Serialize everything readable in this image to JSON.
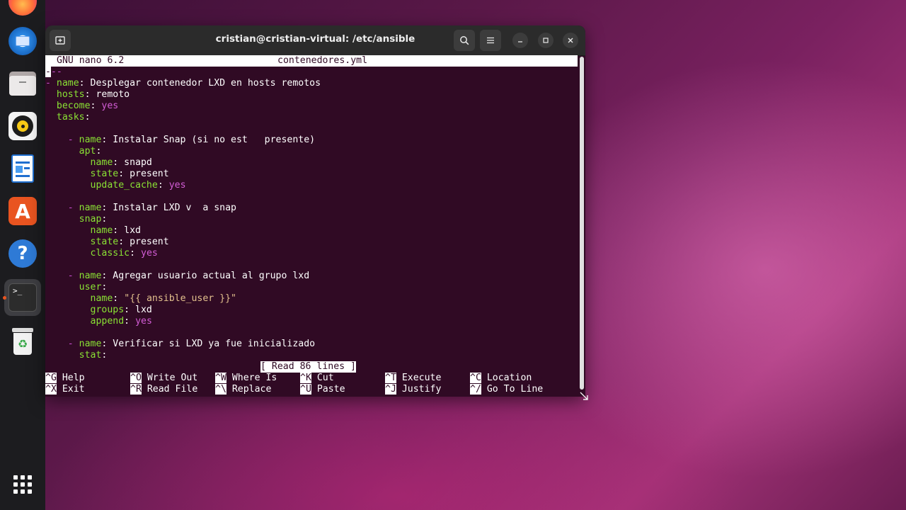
{
  "window": {
    "title": "cristian@cristian-virtual: /etc/ansible"
  },
  "dock": {
    "items": [
      {
        "name": "firefox-icon"
      },
      {
        "name": "thunderbird-icon"
      },
      {
        "name": "files-icon"
      },
      {
        "name": "rhythmbox-icon"
      },
      {
        "name": "libreoffice-writer-icon"
      },
      {
        "name": "app-center-icon"
      },
      {
        "name": "help-icon"
      },
      {
        "name": "terminal-icon"
      },
      {
        "name": "trash-icon"
      },
      {
        "name": "show-apps-icon"
      }
    ]
  },
  "nano": {
    "version": "GNU nano 6.2",
    "filename": "contenedores.yml",
    "status": "[ Read 86 lines ]",
    "lines": [
      [
        [
          "d",
          "---"
        ]
      ],
      [
        [
          "d",
          "- "
        ],
        [
          "k",
          "name"
        ],
        [
          "v",
          ": Desplegar contenedor LXD en hosts remotos"
        ]
      ],
      [
        [
          "v",
          "  "
        ],
        [
          "k",
          "hosts"
        ],
        [
          "v",
          ": remoto"
        ]
      ],
      [
        [
          "v",
          "  "
        ],
        [
          "k",
          "become"
        ],
        [
          "v",
          ": "
        ],
        [
          "b",
          "yes"
        ]
      ],
      [
        [
          "v",
          "  "
        ],
        [
          "k",
          "tasks"
        ],
        [
          "v",
          ":"
        ]
      ],
      [
        [
          "v",
          ""
        ]
      ],
      [
        [
          "d",
          "    - "
        ],
        [
          "k",
          "name"
        ],
        [
          "v",
          ": Instalar Snap (si no est   presente)"
        ]
      ],
      [
        [
          "v",
          "      "
        ],
        [
          "k",
          "apt"
        ],
        [
          "v",
          ":"
        ]
      ],
      [
        [
          "v",
          "        "
        ],
        [
          "k",
          "name"
        ],
        [
          "v",
          ": snapd"
        ]
      ],
      [
        [
          "v",
          "        "
        ],
        [
          "k",
          "state"
        ],
        [
          "v",
          ": present"
        ]
      ],
      [
        [
          "v",
          "        "
        ],
        [
          "k",
          "update_cache"
        ],
        [
          "v",
          ": "
        ],
        [
          "b",
          "yes"
        ]
      ],
      [
        [
          "v",
          ""
        ]
      ],
      [
        [
          "d",
          "    - "
        ],
        [
          "k",
          "name"
        ],
        [
          "v",
          ": Instalar LXD v  a snap"
        ]
      ],
      [
        [
          "v",
          "      "
        ],
        [
          "k",
          "snap"
        ],
        [
          "v",
          ":"
        ]
      ],
      [
        [
          "v",
          "        "
        ],
        [
          "k",
          "name"
        ],
        [
          "v",
          ": lxd"
        ]
      ],
      [
        [
          "v",
          "        "
        ],
        [
          "k",
          "state"
        ],
        [
          "v",
          ": present"
        ]
      ],
      [
        [
          "v",
          "        "
        ],
        [
          "k",
          "classic"
        ],
        [
          "v",
          ": "
        ],
        [
          "b",
          "yes"
        ]
      ],
      [
        [
          "v",
          ""
        ]
      ],
      [
        [
          "d",
          "    - "
        ],
        [
          "k",
          "name"
        ],
        [
          "v",
          ": Agregar usuario actual al grupo lxd"
        ]
      ],
      [
        [
          "v",
          "      "
        ],
        [
          "k",
          "user"
        ],
        [
          "v",
          ":"
        ]
      ],
      [
        [
          "v",
          "        "
        ],
        [
          "k",
          "name"
        ],
        [
          "v",
          ": "
        ],
        [
          "q",
          "\"{{ ansible_user }}\""
        ]
      ],
      [
        [
          "v",
          "        "
        ],
        [
          "k",
          "groups"
        ],
        [
          "v",
          ": lxd"
        ]
      ],
      [
        [
          "v",
          "        "
        ],
        [
          "k",
          "append"
        ],
        [
          "v",
          ": "
        ],
        [
          "b",
          "yes"
        ]
      ],
      [
        [
          "v",
          ""
        ]
      ],
      [
        [
          "d",
          "    - "
        ],
        [
          "k",
          "name"
        ],
        [
          "v",
          ": Verificar si LXD ya fue inicializado"
        ]
      ],
      [
        [
          "v",
          "      "
        ],
        [
          "k",
          "stat"
        ],
        [
          "v",
          ":"
        ]
      ]
    ],
    "shortcuts": [
      {
        "key": "^G",
        "label": "Help"
      },
      {
        "key": "^X",
        "label": "Exit"
      },
      {
        "key": "^O",
        "label": "Write Out"
      },
      {
        "key": "^R",
        "label": "Read File"
      },
      {
        "key": "^W",
        "label": "Where Is"
      },
      {
        "key": "^\\",
        "label": "Replace"
      },
      {
        "key": "^K",
        "label": "Cut"
      },
      {
        "key": "^U",
        "label": "Paste"
      },
      {
        "key": "^T",
        "label": "Execute"
      },
      {
        "key": "^J",
        "label": "Justify"
      },
      {
        "key": "^C",
        "label": "Location"
      },
      {
        "key": "^/",
        "label": "Go To Line"
      }
    ]
  },
  "colors": {
    "terminal_bg": "#300a24",
    "yaml_key": "#8ae234",
    "yaml_bool": "#d35dd6",
    "accent": "#e95420"
  }
}
